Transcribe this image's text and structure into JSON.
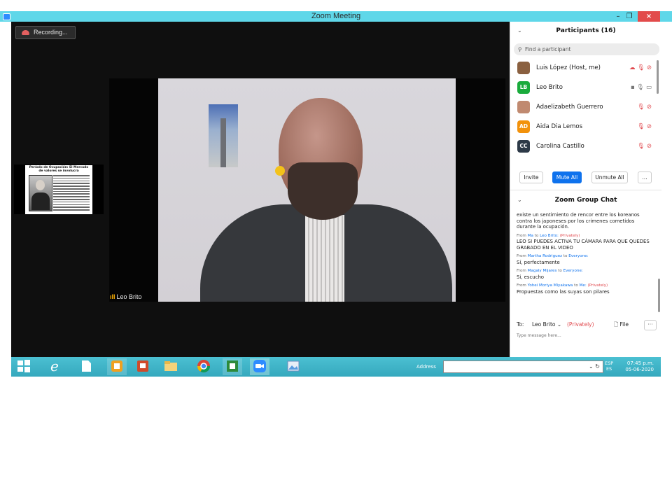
{
  "window": {
    "title": "Zoom Meeting",
    "min": "–",
    "max": "❐",
    "close": "×"
  },
  "recording": {
    "label": "Recording..."
  },
  "slide": {
    "title": "Período de Ocupación: El Mercado de valores se involucra"
  },
  "video": {
    "name": "Leo Brito",
    "signal": "ıll"
  },
  "participants": {
    "chevron": "⌄",
    "title": "Participants (16)",
    "search_icon": "⚲",
    "search_placeholder": "Find a participant",
    "items": [
      {
        "name": "Luis López (Host, me)",
        "initials": "",
        "color": "#8a6040",
        "icons": "☁ 🎙 ⊘",
        "icon_names": "cloud-icon mic-muted-icon video-off-icon"
      },
      {
        "name": "Leo Brito",
        "initials": "LB",
        "color": "#1aab3c",
        "icons": "▪ 🎙 ▭",
        "icon_names": "share-icon mic-icon video-icon"
      },
      {
        "name": "Adaelizabeth Guerrero",
        "initials": "",
        "color": "#c08a70",
        "icons": "🎙 ⊘",
        "icon_names": "mic-muted-icon video-off-icon"
      },
      {
        "name": "Aida Dia Lemos",
        "initials": "AD",
        "color": "#f2920c",
        "icons": "🎙 ⊘",
        "icon_names": "mic-muted-icon video-off-icon"
      },
      {
        "name": "Carolina Castillo",
        "initials": "CC",
        "color": "#2d3a48",
        "icons": "🎙 ⊘",
        "icon_names": "mic-muted-icon video-off-icon"
      }
    ],
    "invite": "Invite",
    "mute_all": "Mute All",
    "unmute_all": "Unmute All",
    "more": "..."
  },
  "chat": {
    "chevron": "⌄",
    "title": "Zoom Group Chat",
    "messages": [
      {
        "from": "",
        "to": "",
        "privately": "",
        "text": "existe un sentimiento de rencor entre los koreanos contra los japoneses por los crimenes cometidos durante la ocupación."
      },
      {
        "from": "Ma",
        "to": "Leo Brito:",
        "privately": "(Privately)",
        "text": "LEO SI PUEDES ACTIVA TU CÁMARA PARA QUE QUEDES GRABADO EN EL VIDEO"
      },
      {
        "from": "Martha Rodriguez",
        "to": "Everyone:",
        "privately": "",
        "text": "Sí, perfectamente"
      },
      {
        "from": "Magaly Mijares",
        "to": "Everyone:",
        "privately": "",
        "text": "Si, escucho"
      },
      {
        "from": "Yohei Moriya Miyakawa",
        "to": "Me:",
        "privately": "(Privately)",
        "text": "Propuestas como las suyas son pilares"
      }
    ],
    "to_label": "To:",
    "to_value": "Leo Brito ⌄",
    "to_privately": "(Privately)",
    "file_label": "🗋 File",
    "more": "···",
    "input_placeholder": "Type message here..."
  },
  "taskbar": {
    "address_label": "Address",
    "address_controls": "⌄ ↻",
    "lang_top": "ESP",
    "lang_bottom": "ES",
    "time": "07:45 p.m.",
    "date": "05-06-2020"
  }
}
